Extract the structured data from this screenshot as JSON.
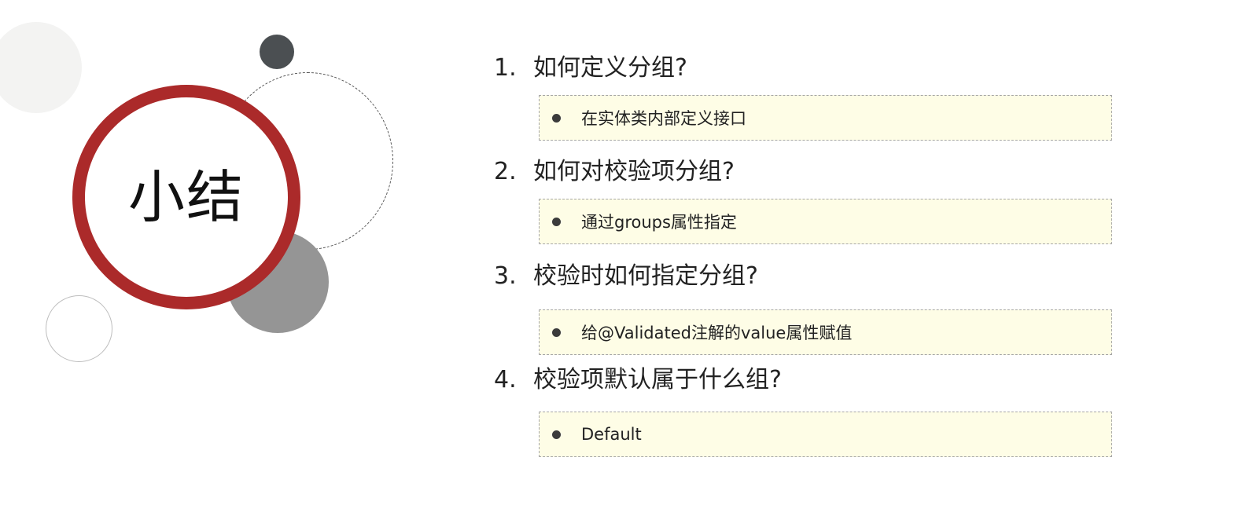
{
  "title": "小结",
  "items": [
    {
      "number": "1.",
      "question": "如何定义分组?",
      "answer": "在实体类内部定义接口"
    },
    {
      "number": "2.",
      "question": "如何对校验项分组?",
      "answer": "通过groups属性指定"
    },
    {
      "number": "3.",
      "question": "校验时如何指定分组?",
      "answer": "给@Validated注解的value属性赋值"
    },
    {
      "number": "4.",
      "question": "校验项默认属于什么组?",
      "answer": "Default"
    }
  ]
}
